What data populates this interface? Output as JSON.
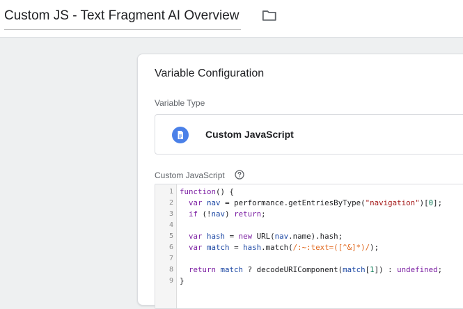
{
  "header": {
    "title": "Custom JS - Text Fragment AI Overview"
  },
  "card": {
    "title": "Variable Configuration",
    "type_label": "Variable Type",
    "type_name": "Custom JavaScript",
    "code_label": "Custom JavaScript"
  },
  "code": {
    "line_numbers": [
      "1",
      "2",
      "3",
      "4",
      "5",
      "6",
      "7",
      "8",
      "9"
    ],
    "lines": [
      [
        {
          "t": "function",
          "c": "kw"
        },
        {
          "t": "() {",
          "c": ""
        }
      ],
      [
        {
          "t": "  ",
          "c": ""
        },
        {
          "t": "var",
          "c": "kw"
        },
        {
          "t": " ",
          "c": ""
        },
        {
          "t": "nav",
          "c": "var"
        },
        {
          "t": " = performance.getEntriesByType(",
          "c": ""
        },
        {
          "t": "\"navigation\"",
          "c": "str"
        },
        {
          "t": ")[",
          "c": ""
        },
        {
          "t": "0",
          "c": "num"
        },
        {
          "t": "];",
          "c": ""
        }
      ],
      [
        {
          "t": "  ",
          "c": ""
        },
        {
          "t": "if",
          "c": "kw"
        },
        {
          "t": " (!",
          "c": ""
        },
        {
          "t": "nav",
          "c": "var"
        },
        {
          "t": ") ",
          "c": ""
        },
        {
          "t": "return",
          "c": "kw"
        },
        {
          "t": ";",
          "c": ""
        }
      ],
      [],
      [
        {
          "t": "  ",
          "c": ""
        },
        {
          "t": "var",
          "c": "kw"
        },
        {
          "t": " ",
          "c": ""
        },
        {
          "t": "hash",
          "c": "var"
        },
        {
          "t": " = ",
          "c": ""
        },
        {
          "t": "new",
          "c": "kw"
        },
        {
          "t": " URL(",
          "c": ""
        },
        {
          "t": "nav",
          "c": "var"
        },
        {
          "t": ".name).hash;",
          "c": ""
        }
      ],
      [
        {
          "t": "  ",
          "c": ""
        },
        {
          "t": "var",
          "c": "kw"
        },
        {
          "t": " ",
          "c": ""
        },
        {
          "t": "match",
          "c": "var"
        },
        {
          "t": " = ",
          "c": ""
        },
        {
          "t": "hash",
          "c": "var"
        },
        {
          "t": ".match(",
          "c": ""
        },
        {
          "t": "/:~:text=([^&]*)/",
          "c": "re"
        },
        {
          "t": ");",
          "c": ""
        }
      ],
      [],
      [
        {
          "t": "  ",
          "c": ""
        },
        {
          "t": "return",
          "c": "kw"
        },
        {
          "t": " ",
          "c": ""
        },
        {
          "t": "match",
          "c": "var"
        },
        {
          "t": " ? decodeURIComponent(",
          "c": ""
        },
        {
          "t": "match",
          "c": "var"
        },
        {
          "t": "[",
          "c": ""
        },
        {
          "t": "1",
          "c": "num"
        },
        {
          "t": "]) : ",
          "c": ""
        },
        {
          "t": "undefined",
          "c": "kw"
        },
        {
          "t": ";",
          "c": ""
        }
      ],
      [
        {
          "t": "}",
          "c": ""
        }
      ]
    ]
  },
  "icons": {
    "folder": "folder-icon",
    "variable_type": "document-icon",
    "help": "help-circle-icon"
  },
  "colors": {
    "background": "#eef0f1",
    "type_icon": "#4a80e8"
  }
}
